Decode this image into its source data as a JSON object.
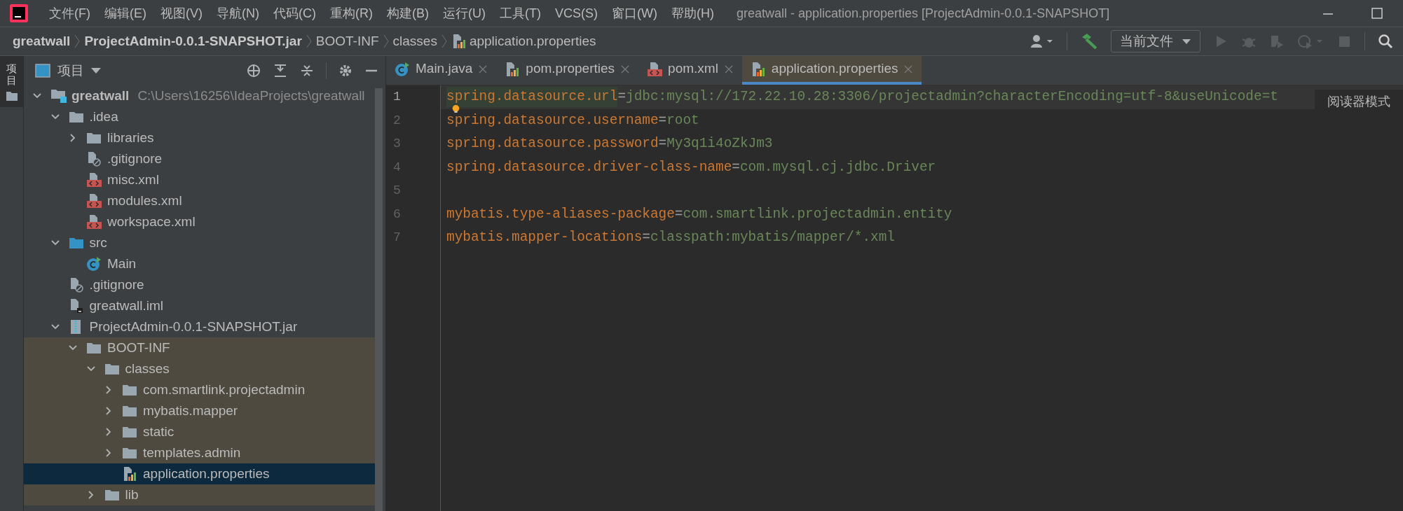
{
  "window": {
    "title": "greatwall - application.properties [ProjectAdmin-0.0.1-SNAPSHOT]"
  },
  "menu": [
    "文件(F)",
    "编辑(E)",
    "视图(V)",
    "导航(N)",
    "代码(C)",
    "重构(R)",
    "构建(B)",
    "运行(U)",
    "工具(T)",
    "VCS(S)",
    "窗口(W)",
    "帮助(H)"
  ],
  "breadcrumbs": [
    {
      "label": "greatwall",
      "bold": true
    },
    {
      "label": "ProjectAdmin-0.0.1-SNAPSHOT.jar",
      "bold": true
    },
    {
      "label": "BOOT-INF",
      "bold": false
    },
    {
      "label": "classes",
      "bold": false
    },
    {
      "label": "application.properties",
      "bold": false
    }
  ],
  "toolbar": {
    "run_config": "当前文件"
  },
  "side_strip": {
    "tab": "项目"
  },
  "project_panel": {
    "title": "项目"
  },
  "tree": [
    {
      "name": "greatwall",
      "path": "C:\\Users\\16256\\IdeaProjects\\greatwall",
      "kind": "module",
      "bold": true,
      "expanded": true,
      "selected": false,
      "shaded": false,
      "children": [
        {
          "name": ".idea",
          "kind": "folder",
          "expanded": true,
          "selected": false,
          "shaded": false,
          "children": [
            {
              "name": "libraries",
              "kind": "folder",
              "expanded": false,
              "selected": false,
              "shaded": false
            },
            {
              "name": ".gitignore",
              "kind": "ignore",
              "selected": false,
              "shaded": false
            },
            {
              "name": "misc.xml",
              "kind": "xml",
              "selected": false,
              "shaded": false
            },
            {
              "name": "modules.xml",
              "kind": "xml",
              "selected": false,
              "shaded": false
            },
            {
              "name": "workspace.xml",
              "kind": "xml",
              "selected": false,
              "shaded": false
            }
          ]
        },
        {
          "name": "src",
          "kind": "source",
          "expanded": true,
          "selected": false,
          "shaded": false,
          "children": [
            {
              "name": "Main",
              "kind": "class",
              "selected": false,
              "shaded": false
            }
          ]
        },
        {
          "name": ".gitignore",
          "kind": "ignore",
          "selected": false,
          "shaded": false
        },
        {
          "name": "greatwall.iml",
          "kind": "iml",
          "selected": false,
          "shaded": false
        },
        {
          "name": "ProjectAdmin-0.0.1-SNAPSHOT.jar",
          "kind": "jar",
          "expanded": true,
          "selected": false,
          "shaded": false,
          "children": [
            {
              "name": "BOOT-INF",
              "kind": "folder",
              "expanded": true,
              "selected": false,
              "shaded": true,
              "children": [
                {
                  "name": "classes",
                  "kind": "folder",
                  "expanded": true,
                  "selected": false,
                  "shaded": true,
                  "children": [
                    {
                      "name": "com.smartlink.projectadmin",
                      "kind": "folder",
                      "expanded": false,
                      "selected": false,
                      "shaded": true
                    },
                    {
                      "name": "mybatis.mapper",
                      "kind": "folder",
                      "expanded": false,
                      "selected": false,
                      "shaded": true
                    },
                    {
                      "name": "static",
                      "kind": "folder",
                      "expanded": false,
                      "selected": false,
                      "shaded": true
                    },
                    {
                      "name": "templates.admin",
                      "kind": "folder",
                      "expanded": false,
                      "selected": false,
                      "shaded": true
                    },
                    {
                      "name": "application.properties",
                      "kind": "properties",
                      "selected": true
                    }
                  ]
                },
                {
                  "name": "lib",
                  "kind": "folder",
                  "expanded": false,
                  "selected": false,
                  "shaded": true
                }
              ]
            }
          ]
        }
      ]
    }
  ],
  "tabs": [
    {
      "label": "Main.java",
      "kind": "class",
      "selected": false,
      "shaded": false
    },
    {
      "label": "pom.properties",
      "kind": "properties",
      "selected": false,
      "shaded": false
    },
    {
      "label": "pom.xml",
      "kind": "xml",
      "selected": false,
      "shaded": false
    },
    {
      "label": "application.properties",
      "kind": "properties",
      "selected": true,
      "shaded": true
    }
  ],
  "editor": {
    "reader_mode": "阅读器模式",
    "lines": [
      {
        "number": "1",
        "key": "spring.datasource.url",
        "sep": "=",
        "value": "jdbc:mysql://172.22.10.28:3306/projectadmin?characterEncoding=utf-8&useUnicode=t",
        "current": true,
        "bulb": false
      },
      {
        "number": "2",
        "key": "spring.datasource.username",
        "sep": "=",
        "value": "root",
        "current": false,
        "bulb": true
      },
      {
        "number": "3",
        "key": "spring.datasource.password",
        "sep": "=",
        "value": "My3q1i4oZkJm3",
        "current": false,
        "bulb": false
      },
      {
        "number": "4",
        "key": "spring.datasource.driver-class-name",
        "sep": "=",
        "value": "com.mysql.cj.jdbc.Driver",
        "current": false,
        "bulb": false
      },
      {
        "number": "5",
        "current": false,
        "bulb": false
      },
      {
        "number": "6",
        "key": "mybatis.type-aliases-package",
        "sep": "=",
        "value": "com.smartlink.projectadmin.entity",
        "current": false,
        "bulb": false
      },
      {
        "number": "7",
        "key": "mybatis.mapper-locations",
        "sep": "=",
        "value": "classpath:mybatis/mapper/*.xml",
        "current": false,
        "bulb": false
      }
    ]
  }
}
